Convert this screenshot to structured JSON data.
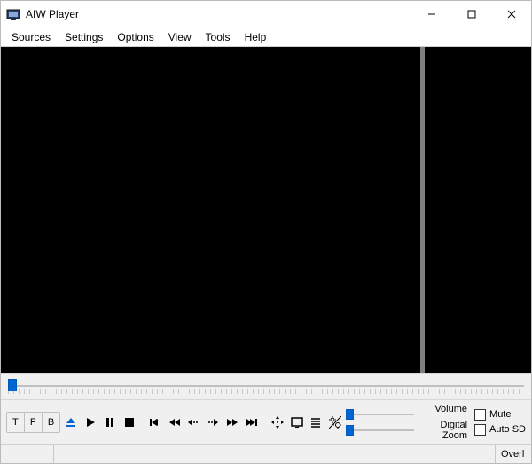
{
  "window": {
    "title": "AIW Player"
  },
  "menu": {
    "sources": "Sources",
    "settings": "Settings",
    "options": "Options",
    "view": "View",
    "tools": "Tools",
    "help": "Help"
  },
  "buttons": {
    "t": "T",
    "f": "F",
    "b": "B"
  },
  "labels": {
    "volume": "Volume",
    "digital_zoom": "Digital Zoom"
  },
  "checkboxes": {
    "mute": "Mute",
    "auto_sd": "Auto SD"
  },
  "status": {
    "overlay": "Overl"
  }
}
